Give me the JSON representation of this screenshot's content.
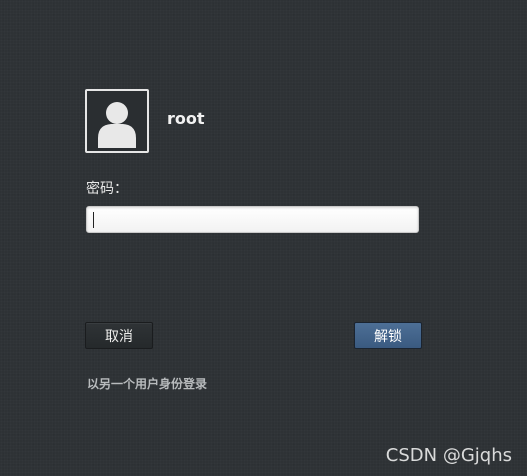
{
  "user": {
    "avatar_icon": "default-user-avatar-icon",
    "name": "root"
  },
  "password": {
    "label": "密码：",
    "value": ""
  },
  "buttons": {
    "cancel": "取消",
    "unlock": "解锁"
  },
  "switch_user_link": "以另一个用户身份登录",
  "watermark": "CSDN @Gjqhs",
  "colors": {
    "background": "#2e3235",
    "unlock_button": "#4a6b91",
    "text": "#eeeeec"
  }
}
